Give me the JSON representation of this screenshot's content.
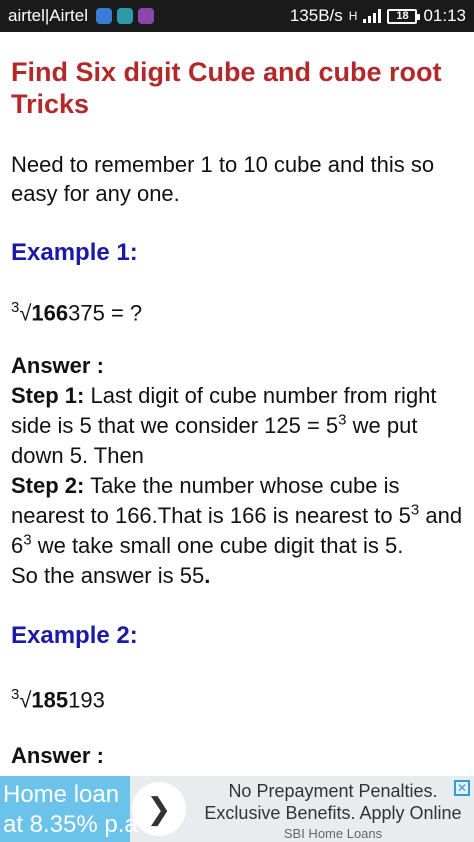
{
  "status_bar": {
    "carrier": "airtel|Airtel",
    "speed": "135B/s",
    "network": "H",
    "battery": "18",
    "time": "01:13"
  },
  "article": {
    "title": "Find Six digit Cube and cube root Tricks",
    "intro": "Need to remember 1 to 10 cube and this so easy for any one.",
    "example1": {
      "heading": "Example 1:",
      "index": "3",
      "radical": "√",
      "num_bold": "166",
      "num_rest": "375 = ?",
      "answer_label": "Answer :",
      "step1_label": "Step 1:",
      "step1_a": " Last digit of cube number from right side is 5 that we consider 125 = 5",
      "step1_exp": "3",
      "step1_b": " we put down 5. Then",
      "step2_label": "Step 2:",
      "step2_a": " Take the number whose cube is nearest to 166.That is 166 is nearest to 5",
      "step2_exp1": "3",
      "step2_b": " and 6",
      "step2_exp2": "3",
      "step2_c": " we take small one cube digit that is 5.",
      "result_a": "So the answer is 55",
      "result_b": "."
    },
    "example2": {
      "heading": "Example 2:",
      "index": "3",
      "radical": "√",
      "num_bold": "185",
      "num_rest": "193",
      "answer_label": "Answer :"
    }
  },
  "ad": {
    "left_line1": "Home loan",
    "left_line2": "at 8.35% p.a",
    "arrow": "❯",
    "headline_line1": "No Prepayment Penalties.",
    "headline_line2": "Exclusive Benefits. Apply Online",
    "sponsor": "SBI Home Loans",
    "close": "✕"
  }
}
